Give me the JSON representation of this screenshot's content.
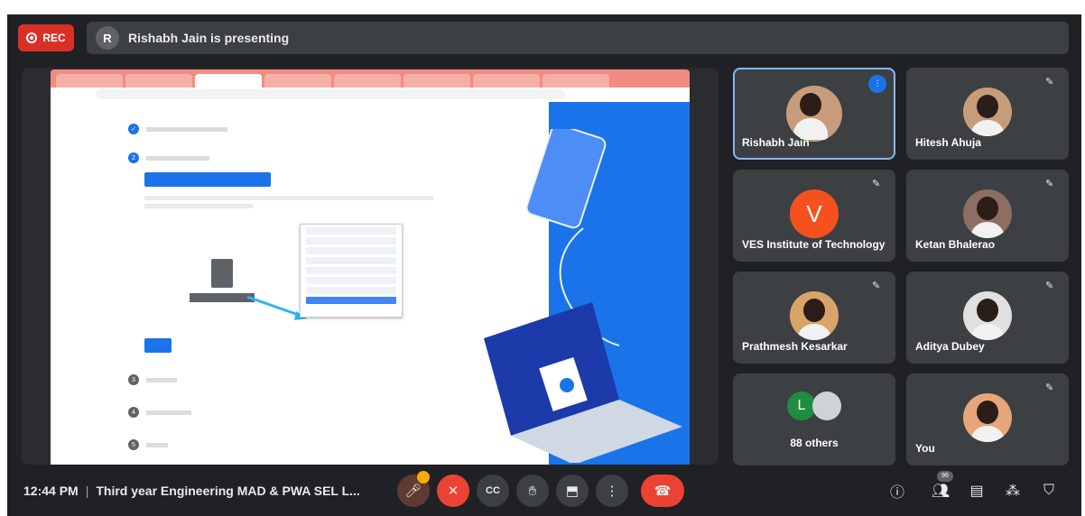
{
  "topbar": {
    "rec_label": "REC",
    "presenting_text": "Rishabh Jain is presenting"
  },
  "shared_screen": {
    "browser_tabs": [
      "",
      "",
      "",
      "",
      "",
      "",
      "",
      ""
    ],
    "address": "",
    "step_labels": [
      "",
      "",
      "",
      "",
      "",
      ""
    ],
    "download_button": "",
    "next_button": "",
    "file_label": ""
  },
  "participants": [
    {
      "name": "Rishabh Jain",
      "type": "photo",
      "speaking": true
    },
    {
      "name": "Hitesh Ahuja",
      "type": "photo",
      "muted": true
    },
    {
      "name": "VES Institute of Technology",
      "type": "letter",
      "letter": "V",
      "muted": true
    },
    {
      "name": "Ketan Bhalerao",
      "type": "photo",
      "muted": true
    },
    {
      "name": "Prathmesh Kesarkar",
      "type": "photo",
      "muted": true
    },
    {
      "name": "Aditya Dubey",
      "type": "photo",
      "muted": true
    },
    {
      "name": "88 others",
      "type": "others",
      "letter": "L"
    },
    {
      "name": "You",
      "type": "photo",
      "muted": true
    }
  ],
  "bottombar": {
    "time": "12:44 PM",
    "separator": "|",
    "meeting_title": "Third year Engineering MAD & PWA SEL L...",
    "people_count": "96",
    "controls": [
      "mic-icon",
      "camera-off-icon",
      "captions-icon",
      "raise-hand-icon",
      "present-icon",
      "more-options-icon",
      "hang-up-icon"
    ],
    "right_icons": [
      "info-icon",
      "people-icon",
      "chat-icon",
      "activities-icon",
      "host-controls-icon"
    ]
  },
  "colors": {
    "meet_bg": "#202124",
    "tile_bg": "#3c4043",
    "rec_red": "#d93025",
    "hangup_red": "#ea4335",
    "accent_blue": "#1a73e8",
    "avatar_orange": "#f4511e",
    "avatar_green": "#1e8e3e"
  }
}
